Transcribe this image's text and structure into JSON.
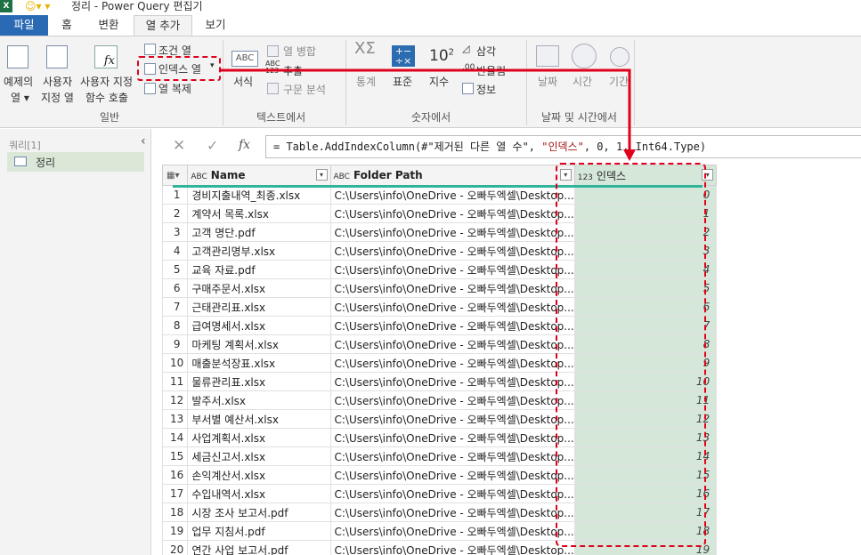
{
  "window": {
    "title": "정리 - Power Query 편집기",
    "app_icon": "X"
  },
  "tabs": [
    "파일",
    "홈",
    "변환",
    "열 추가",
    "보기"
  ],
  "ribbon": {
    "general": {
      "example_col": [
        "예제의",
        "열 ▾"
      ],
      "custom_col": [
        "사용자",
        "지정 열"
      ],
      "custom_fn": [
        "사용자 지정",
        "함수 호출"
      ],
      "conditional": "조건 열",
      "index": "인덱스 열",
      "duplicate": "열 복제",
      "group": "일반"
    },
    "text": {
      "format": "서식",
      "merge": "열 병합",
      "extract": "추출",
      "parse": "구문 분석",
      "group": "텍스트에서"
    },
    "number": {
      "statistics": "통계",
      "standard": "표준",
      "scientific": "지수",
      "trig": "삼각",
      "rounding": "반올림",
      "info": "정보",
      "group": "숫자에서"
    },
    "datetime": {
      "date": "날짜",
      "time": "시간",
      "duration": "기간",
      "group": "날짜 및 시간에서"
    }
  },
  "queries": {
    "header": "쿼리[1]",
    "items": [
      "정리"
    ]
  },
  "formula": {
    "prefix": "= Table.AddIndexColumn(#\"제거된 다른 열 수\", ",
    "arg": "\"인덱스\"",
    "suffix": ", 0, 1, Int64.Type)"
  },
  "columns": [
    {
      "type": "ABC",
      "name": "Name"
    },
    {
      "type": "ABC",
      "name": "Folder Path"
    },
    {
      "type": "123",
      "name": "인덱스"
    }
  ],
  "rows": [
    [
      "경비지출내역_최종.xlsx",
      "C:\\Users\\info\\OneDrive - 오빠두엑셀\\Desktop...",
      "0"
    ],
    [
      "계약서 목록.xlsx",
      "C:\\Users\\info\\OneDrive - 오빠두엑셀\\Desktop...",
      "1"
    ],
    [
      "고객 명단.pdf",
      "C:\\Users\\info\\OneDrive - 오빠두엑셀\\Desktop...",
      "2"
    ],
    [
      "고객관리명부.xlsx",
      "C:\\Users\\info\\OneDrive - 오빠두엑셀\\Desktop...",
      "3"
    ],
    [
      "교육 자료.pdf",
      "C:\\Users\\info\\OneDrive - 오빠두엑셀\\Desktop...",
      "4"
    ],
    [
      "구매주문서.xlsx",
      "C:\\Users\\info\\OneDrive - 오빠두엑셀\\Desktop...",
      "5"
    ],
    [
      "근태관리표.xlsx",
      "C:\\Users\\info\\OneDrive - 오빠두엑셀\\Desktop...",
      "6"
    ],
    [
      "급여명세서.xlsx",
      "C:\\Users\\info\\OneDrive - 오빠두엑셀\\Desktop...",
      "7"
    ],
    [
      "마케팅 계획서.xlsx",
      "C:\\Users\\info\\OneDrive - 오빠두엑셀\\Desktop...",
      "8"
    ],
    [
      "매출분석장표.xlsx",
      "C:\\Users\\info\\OneDrive - 오빠두엑셀\\Desktop...",
      "9"
    ],
    [
      "물류관리표.xlsx",
      "C:\\Users\\info\\OneDrive - 오빠두엑셀\\Desktop...",
      "10"
    ],
    [
      "발주서.xlsx",
      "C:\\Users\\info\\OneDrive - 오빠두엑셀\\Desktop...",
      "11"
    ],
    [
      "부서별 예산서.xlsx",
      "C:\\Users\\info\\OneDrive - 오빠두엑셀\\Desktop...",
      "12"
    ],
    [
      "사업계획서.xlsx",
      "C:\\Users\\info\\OneDrive - 오빠두엑셀\\Desktop...",
      "13"
    ],
    [
      "세금신고서.xlsx",
      "C:\\Users\\info\\OneDrive - 오빠두엑셀\\Desktop...",
      "14"
    ],
    [
      "손익계산서.xlsx",
      "C:\\Users\\info\\OneDrive - 오빠두엑셀\\Desktop...",
      "15"
    ],
    [
      "수입내역서.xlsx",
      "C:\\Users\\info\\OneDrive - 오빠두엑셀\\Desktop...",
      "16"
    ],
    [
      "시장 조사 보고서.pdf",
      "C:\\Users\\info\\OneDrive - 오빠두엑셀\\Desktop...",
      "17"
    ],
    [
      "업무 지침서.pdf",
      "C:\\Users\\info\\OneDrive - 오빠두엑셀\\Desktop...",
      "18"
    ],
    [
      "연간 사업 보고서.pdf",
      "C:\\Users\\info\\OneDrive - 오빠두엑셀\\Desktop...",
      "19"
    ]
  ],
  "colors": {
    "accent": "#2a6ab5",
    "highlight": "#e0001b",
    "selected_column": "#d5e7d9",
    "quality_bar": "#2fb39a"
  }
}
